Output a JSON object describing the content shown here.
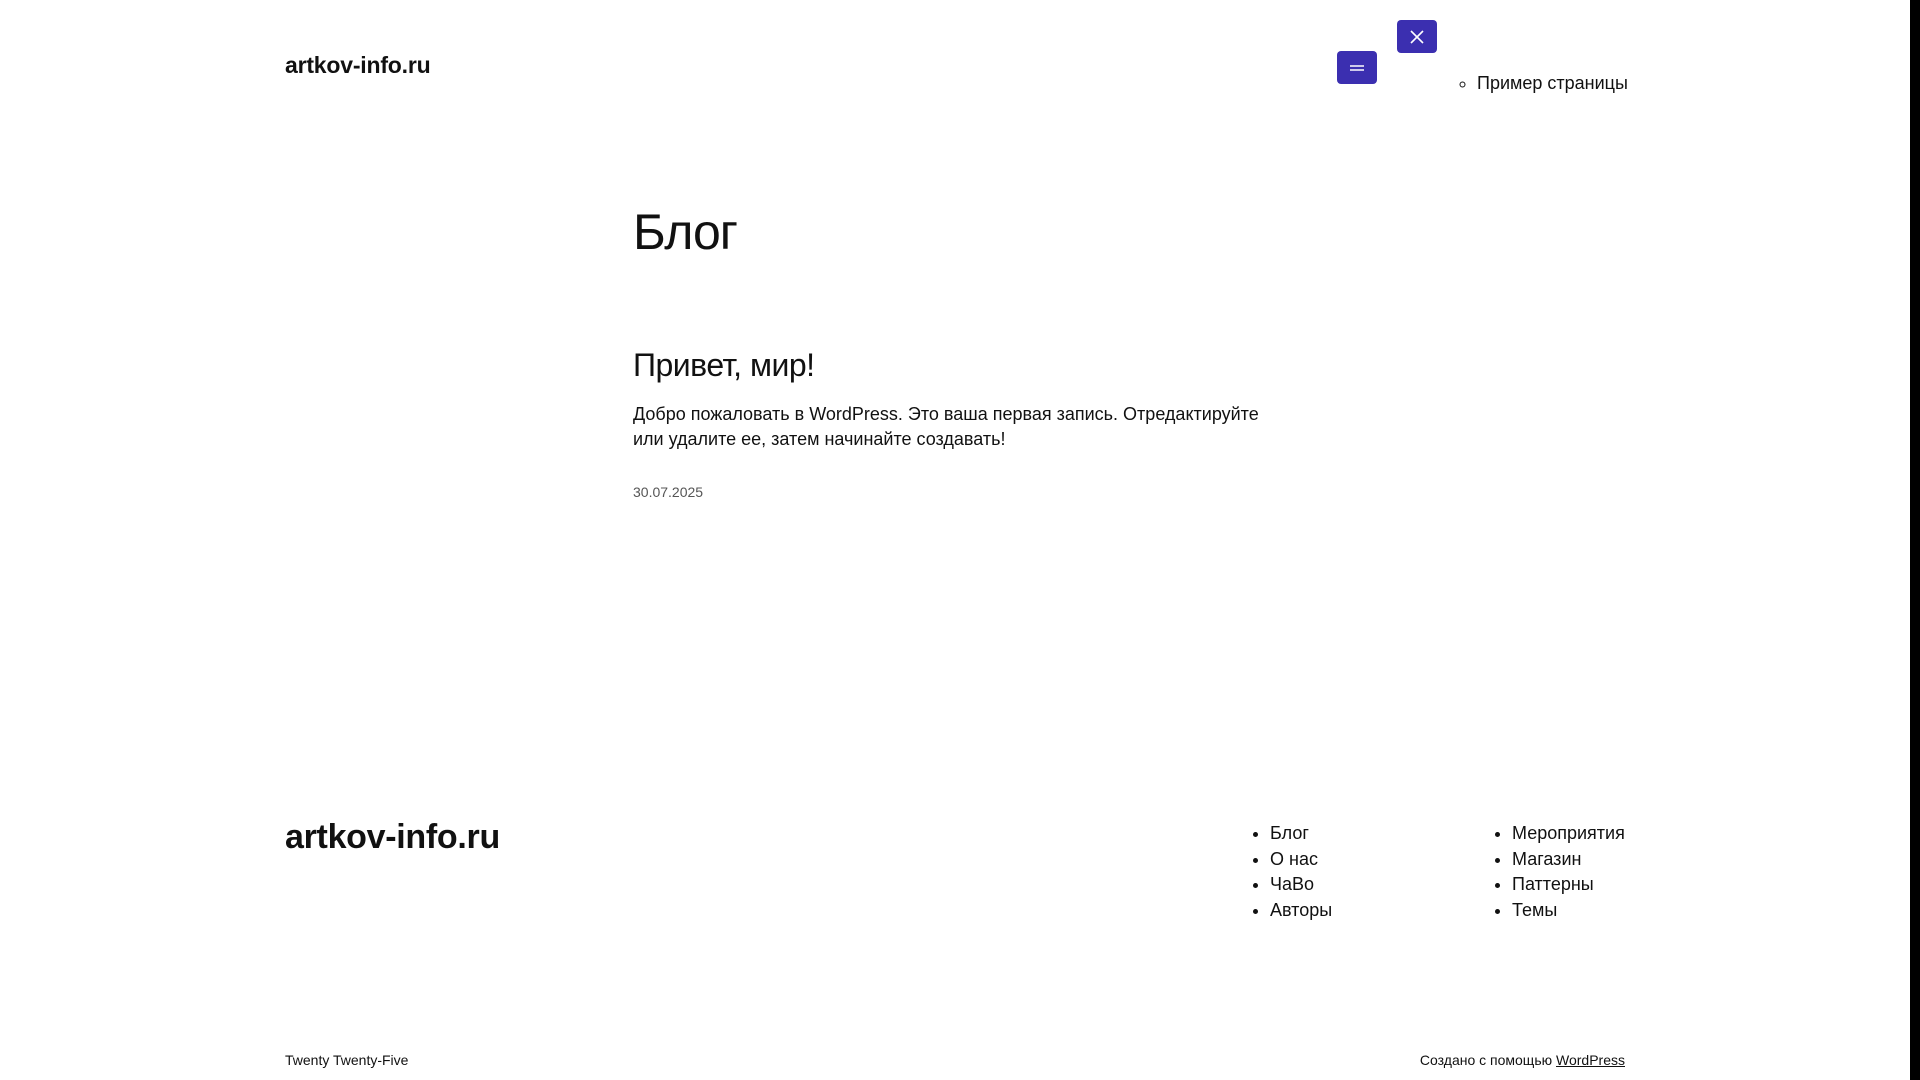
{
  "header": {
    "site_title": "artkov-info.ru",
    "submenu_item": "Пример страницы"
  },
  "main": {
    "heading": "Блог",
    "post": {
      "title": "Привет, мир!",
      "excerpt": "Добро пожаловать в WordPress. Это ваша первая запись. Отредактируйте или удалите ее, затем начинайте создавать!",
      "date": "30.07.2025"
    }
  },
  "footer": {
    "site_title": "artkov-info.ru",
    "col1": [
      {
        "label": "Блог"
      },
      {
        "label": "О нас"
      },
      {
        "label": "ЧаВо"
      },
      {
        "label": "Авторы"
      }
    ],
    "col2": [
      {
        "label": "Мероприятия"
      },
      {
        "label": "Магазин"
      },
      {
        "label": "Паттерны"
      },
      {
        "label": "Темы"
      }
    ],
    "credit_left": "Twenty Twenty-Five",
    "credit_right_prefix": "Создано с помощью",
    "credit_right_link": "WordPress"
  },
  "icons": {
    "menu": "hamburger-icon",
    "close": "close-icon"
  },
  "colors": {
    "accent": "#3b2fb0",
    "text": "#111111",
    "muted": "#555555"
  }
}
